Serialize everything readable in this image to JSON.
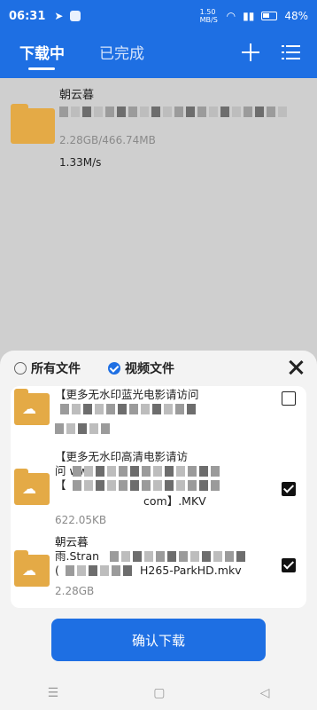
{
  "status_bar": {
    "time": "06:31",
    "network_speed": "1.50 MB/S",
    "battery": "48%"
  },
  "header": {
    "tabs": [
      {
        "label": "下载中",
        "active": true
      },
      {
        "label": "已完成",
        "active": false
      }
    ],
    "icons": [
      "plus-icon",
      "list-icon"
    ],
    "accent_color": "#1e6fe3"
  },
  "download_item": {
    "title": "朝云暮",
    "size_progress": "2.28GB/466.74MB",
    "speed": "1.33M/s"
  },
  "sheet": {
    "filters": [
      {
        "label": "所有文件",
        "selected": false
      },
      {
        "label": "视频文件",
        "selected": true
      }
    ],
    "files": [
      {
        "line1": "【更多无水印蓝光电影请访问",
        "line2": "",
        "size": "",
        "checked": false
      },
      {
        "line1": "【更多无水印高清电影请访",
        "line2": "问 ww",
        "line3": "【",
        "line4": "com】.MKV",
        "size": "622.05KB",
        "checked": true
      },
      {
        "line1": "朝云暮",
        "line2": "雨.Stran",
        "line3": "(",
        "line4": "H265-ParkHD.mkv",
        "size": "2.28GB",
        "checked": true
      }
    ],
    "confirm_label": "确认下载"
  },
  "nav": {
    "menu": "☰",
    "home": "▢",
    "back": "◁"
  }
}
